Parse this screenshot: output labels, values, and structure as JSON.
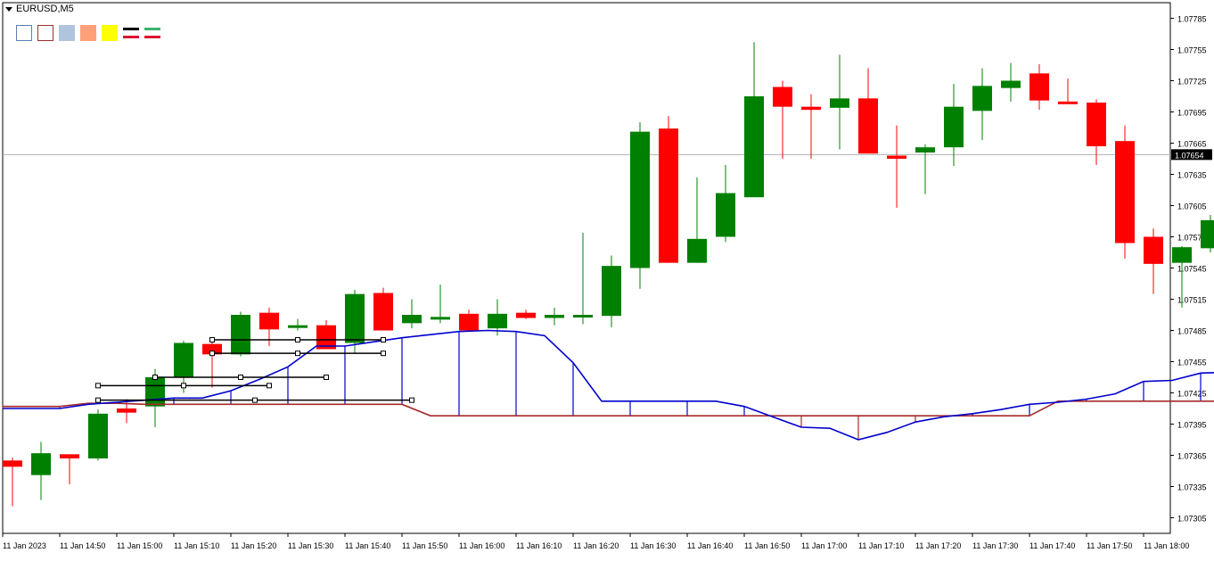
{
  "symbol": "EURUSD,M5",
  "toolbar": {
    "swatches": [
      {
        "icon": "square-outline-blue-icon",
        "border": "#5b7fb5",
        "fill": "#ffffff"
      },
      {
        "icon": "square-outline-red-icon",
        "border": "#a03030",
        "fill": "#ffffff"
      },
      {
        "icon": "square-fill-lightblue-icon",
        "border": "#b0c4de",
        "fill": "#b0c4de"
      },
      {
        "icon": "square-fill-salmon-icon",
        "border": "#ffa07a",
        "fill": "#ffa07a"
      },
      {
        "icon": "square-fill-yellow-icon",
        "border": "#ffff00",
        "fill": "#ffff00"
      }
    ],
    "line_icons": [
      {
        "icon": "line-black-red-icon",
        "top": "#000000",
        "bottom": "#e0102f"
      },
      {
        "icon": "line-green-red-icon",
        "top": "#3cb371",
        "bottom": "#e0102f"
      }
    ]
  },
  "colors": {
    "bull": "#008000",
    "bear": "#ff0000",
    "ma_fast": "#0000cd",
    "ma_slow": "#a52a2a",
    "level_line": "#b0b0b0",
    "price_tag_bg": "#000000",
    "price_tag_text": "#ffffff",
    "axis": "#000000"
  },
  "current_price": "1.07654",
  "chart_data": {
    "type": "candlestick",
    "ylim": [
      1.0729,
      1.078
    ],
    "y_ticks": [
      "1.07785",
      "1.07755",
      "1.07725",
      "1.07695",
      "1.07665",
      "1.07635",
      "1.07605",
      "1.07575",
      "1.07545",
      "1.07515",
      "1.07485",
      "1.07455",
      "1.07425",
      "1.07395",
      "1.07365",
      "1.07335",
      "1.07305"
    ],
    "x_labels": [
      "11 Jan 2023",
      "11 Jan 14:50",
      "11 Jan 15:00",
      "11 Jan 15:10",
      "11 Jan 15:20",
      "11 Jan 15:30",
      "11 Jan 15:40",
      "11 Jan 15:50",
      "11 Jan 16:00",
      "11 Jan 16:10",
      "11 Jan 16:20",
      "11 Jan 16:30",
      "11 Jan 16:40",
      "11 Jan 16:50",
      "11 Jan 17:00",
      "11 Jan 17:10",
      "11 Jan 17:20",
      "11 Jan 17:30",
      "11 Jan 17:40",
      "11 Jan 17:50",
      "11 Jan 18:00"
    ],
    "candles": [
      {
        "o": 1.0736,
        "h": 1.07363,
        "l": 1.07316,
        "c": 1.07354
      },
      {
        "o": 1.07346,
        "h": 1.07378,
        "l": 1.07322,
        "c": 1.07367
      },
      {
        "o": 1.07366,
        "h": 1.07366,
        "l": 1.07337,
        "c": 1.07362
      },
      {
        "o": 1.07362,
        "h": 1.07409,
        "l": 1.0736,
        "c": 1.07405
      },
      {
        "o": 1.0741,
        "h": 1.07419,
        "l": 1.07396,
        "c": 1.07406
      },
      {
        "o": 1.07412,
        "h": 1.07448,
        "l": 1.07392,
        "c": 1.0744
      },
      {
        "o": 1.0744,
        "h": 1.07475,
        "l": 1.07425,
        "c": 1.07473
      },
      {
        "o": 1.07472,
        "h": 1.07475,
        "l": 1.0743,
        "c": 1.07462
      },
      {
        "o": 1.07462,
        "h": 1.07503,
        "l": 1.0746,
        "c": 1.075
      },
      {
        "o": 1.07502,
        "h": 1.07507,
        "l": 1.0747,
        "c": 1.07486
      },
      {
        "o": 1.07489,
        "h": 1.07496,
        "l": 1.07485,
        "c": 1.0749
      },
      {
        "o": 1.0749,
        "h": 1.07495,
        "l": 1.07475,
        "c": 1.07467
      },
      {
        "o": 1.07473,
        "h": 1.07524,
        "l": 1.07463,
        "c": 1.0752
      },
      {
        "o": 1.07521,
        "h": 1.07526,
        "l": 1.07485,
        "c": 1.07485
      },
      {
        "o": 1.07492,
        "h": 1.07515,
        "l": 1.07487,
        "c": 1.075
      },
      {
        "o": 1.07496,
        "h": 1.07529,
        "l": 1.07492,
        "c": 1.07498
      },
      {
        "o": 1.07501,
        "h": 1.07505,
        "l": 1.07487,
        "c": 1.07485
      },
      {
        "o": 1.07487,
        "h": 1.07515,
        "l": 1.0748,
        "c": 1.07501
      },
      {
        "o": 1.07502,
        "h": 1.07505,
        "l": 1.07496,
        "c": 1.07497
      },
      {
        "o": 1.07497,
        "h": 1.07507,
        "l": 1.0749,
        "c": 1.075
      },
      {
        "o": 1.07499,
        "h": 1.07579,
        "l": 1.07491,
        "c": 1.075
      },
      {
        "o": 1.07499,
        "h": 1.07557,
        "l": 1.07488,
        "c": 1.07547
      },
      {
        "o": 1.07545,
        "h": 1.07685,
        "l": 1.07525,
        "c": 1.07676
      },
      {
        "o": 1.07679,
        "h": 1.07691,
        "l": 1.0755,
        "c": 1.0755
      },
      {
        "o": 1.0755,
        "h": 1.07632,
        "l": 1.0755,
        "c": 1.07573
      },
      {
        "o": 1.07575,
        "h": 1.07644,
        "l": 1.0757,
        "c": 1.07617
      },
      {
        "o": 1.07613,
        "h": 1.07762,
        "l": 1.07613,
        "c": 1.0771
      },
      {
        "o": 1.07719,
        "h": 1.07725,
        "l": 1.0765,
        "c": 1.077
      },
      {
        "o": 1.077,
        "h": 1.07712,
        "l": 1.0765,
        "c": 1.07697
      },
      {
        "o": 1.07699,
        "h": 1.0775,
        "l": 1.07659,
        "c": 1.07708
      },
      {
        "o": 1.07708,
        "h": 1.07737,
        "l": 1.07655,
        "c": 1.07655
      },
      {
        "o": 1.07653,
        "h": 1.07682,
        "l": 1.07603,
        "c": 1.0765
      },
      {
        "o": 1.07656,
        "h": 1.07664,
        "l": 1.07616,
        "c": 1.07661
      },
      {
        "o": 1.07661,
        "h": 1.07722,
        "l": 1.07643,
        "c": 1.077
      },
      {
        "o": 1.07696,
        "h": 1.07737,
        "l": 1.07668,
        "c": 1.0772
      },
      {
        "o": 1.07718,
        "h": 1.07742,
        "l": 1.07705,
        "c": 1.07725
      },
      {
        "o": 1.07732,
        "h": 1.07741,
        "l": 1.07697,
        "c": 1.07706
      },
      {
        "o": 1.07705,
        "h": 1.07727,
        "l": 1.07703,
        "c": 1.07704
      },
      {
        "o": 1.07704,
        "h": 1.07707,
        "l": 1.07644,
        "c": 1.07662
      },
      {
        "o": 1.07667,
        "h": 1.07682,
        "l": 1.07554,
        "c": 1.07569
      },
      {
        "o": 1.07575,
        "h": 1.07583,
        "l": 1.0752,
        "c": 1.07549
      },
      {
        "o": 1.0755,
        "h": 1.07566,
        "l": 1.07507,
        "c": 1.07565
      },
      {
        "o": 1.07564,
        "h": 1.07596,
        "l": 1.0756,
        "c": 1.07591
      }
    ],
    "ma_fast": [
      1.0741,
      1.0741,
      1.0741,
      1.07414,
      1.07416,
      1.07418,
      1.0742,
      1.0742,
      1.07427,
      1.07438,
      1.0745,
      1.0747,
      1.0747,
      1.07474,
      1.07478,
      1.07481,
      1.07484,
      1.07485,
      1.07484,
      1.0748,
      1.07454,
      1.07417,
      1.07417,
      1.07417,
      1.07417,
      1.07417,
      1.07412,
      1.07402,
      1.07392,
      1.07391,
      1.0738,
      1.07387,
      1.07397,
      1.07402,
      1.07405,
      1.07409,
      1.07414,
      1.07416,
      1.07419,
      1.07424,
      1.07436,
      1.07437,
      1.07444,
      1.07445
    ],
    "ma_slow": [
      1.07412,
      1.07412,
      1.07412,
      1.07415,
      1.07415,
      1.07414,
      1.07414,
      1.07414,
      1.07414,
      1.07414,
      1.07414,
      1.07414,
      1.07414,
      1.07414,
      1.07414,
      1.07403,
      1.07403,
      1.07403,
      1.07403,
      1.07403,
      1.07403,
      1.07403,
      1.07403,
      1.07403,
      1.07403,
      1.07403,
      1.07403,
      1.07403,
      1.07403,
      1.07403,
      1.07403,
      1.07403,
      1.07403,
      1.07403,
      1.07403,
      1.07403,
      1.07403,
      1.07417,
      1.07417,
      1.07417,
      1.07417,
      1.07417,
      1.07417,
      1.07417
    ]
  }
}
